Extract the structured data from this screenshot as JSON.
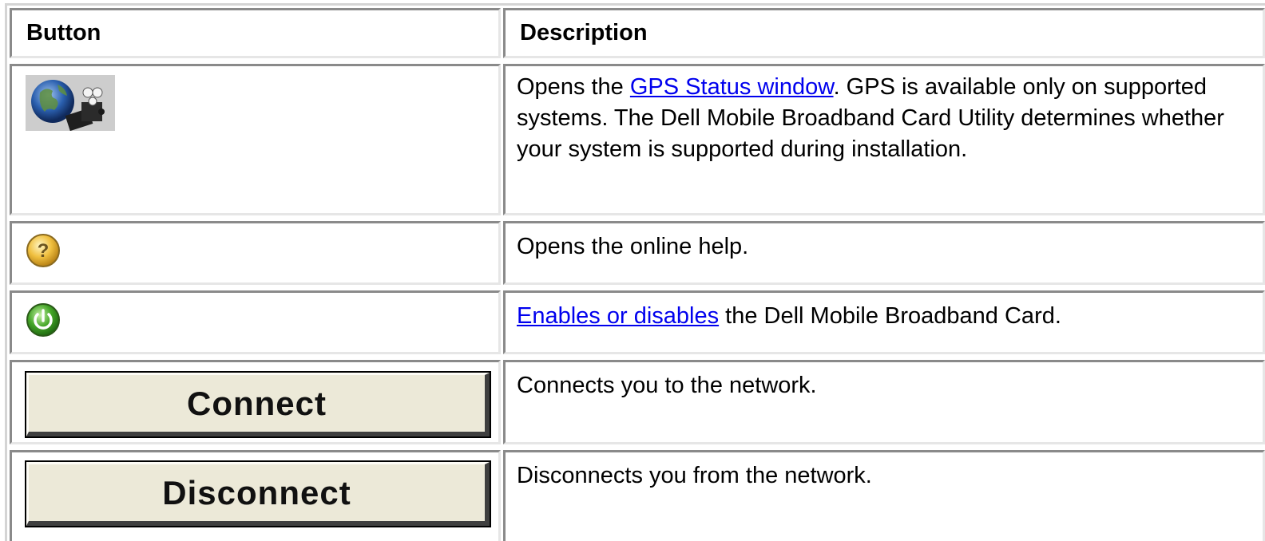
{
  "table": {
    "header": {
      "button": "Button",
      "description": "Description"
    },
    "rows": [
      {
        "icon": "gps-status-icon",
        "pre": "Opens the ",
        "link": "GPS Status window",
        "post": ". GPS is available only on supported systems. The Dell Mobile Broadband Card Utility determines whether your system is supported during installation."
      },
      {
        "icon": "help-icon",
        "text": "Opens the online help."
      },
      {
        "icon": "power-icon",
        "link": "Enables or disables",
        "post": " the Dell Mobile Broadband Card."
      },
      {
        "button_label": "Connect",
        "text": "Connects you to the network."
      },
      {
        "button_label": "Disconnect",
        "text": "Disconnects you from the network."
      }
    ]
  },
  "colors": {
    "link": "#0000ee",
    "button_face": "#ece9d8",
    "help_icon": "#f0c040",
    "power_icon": "#45a628"
  }
}
